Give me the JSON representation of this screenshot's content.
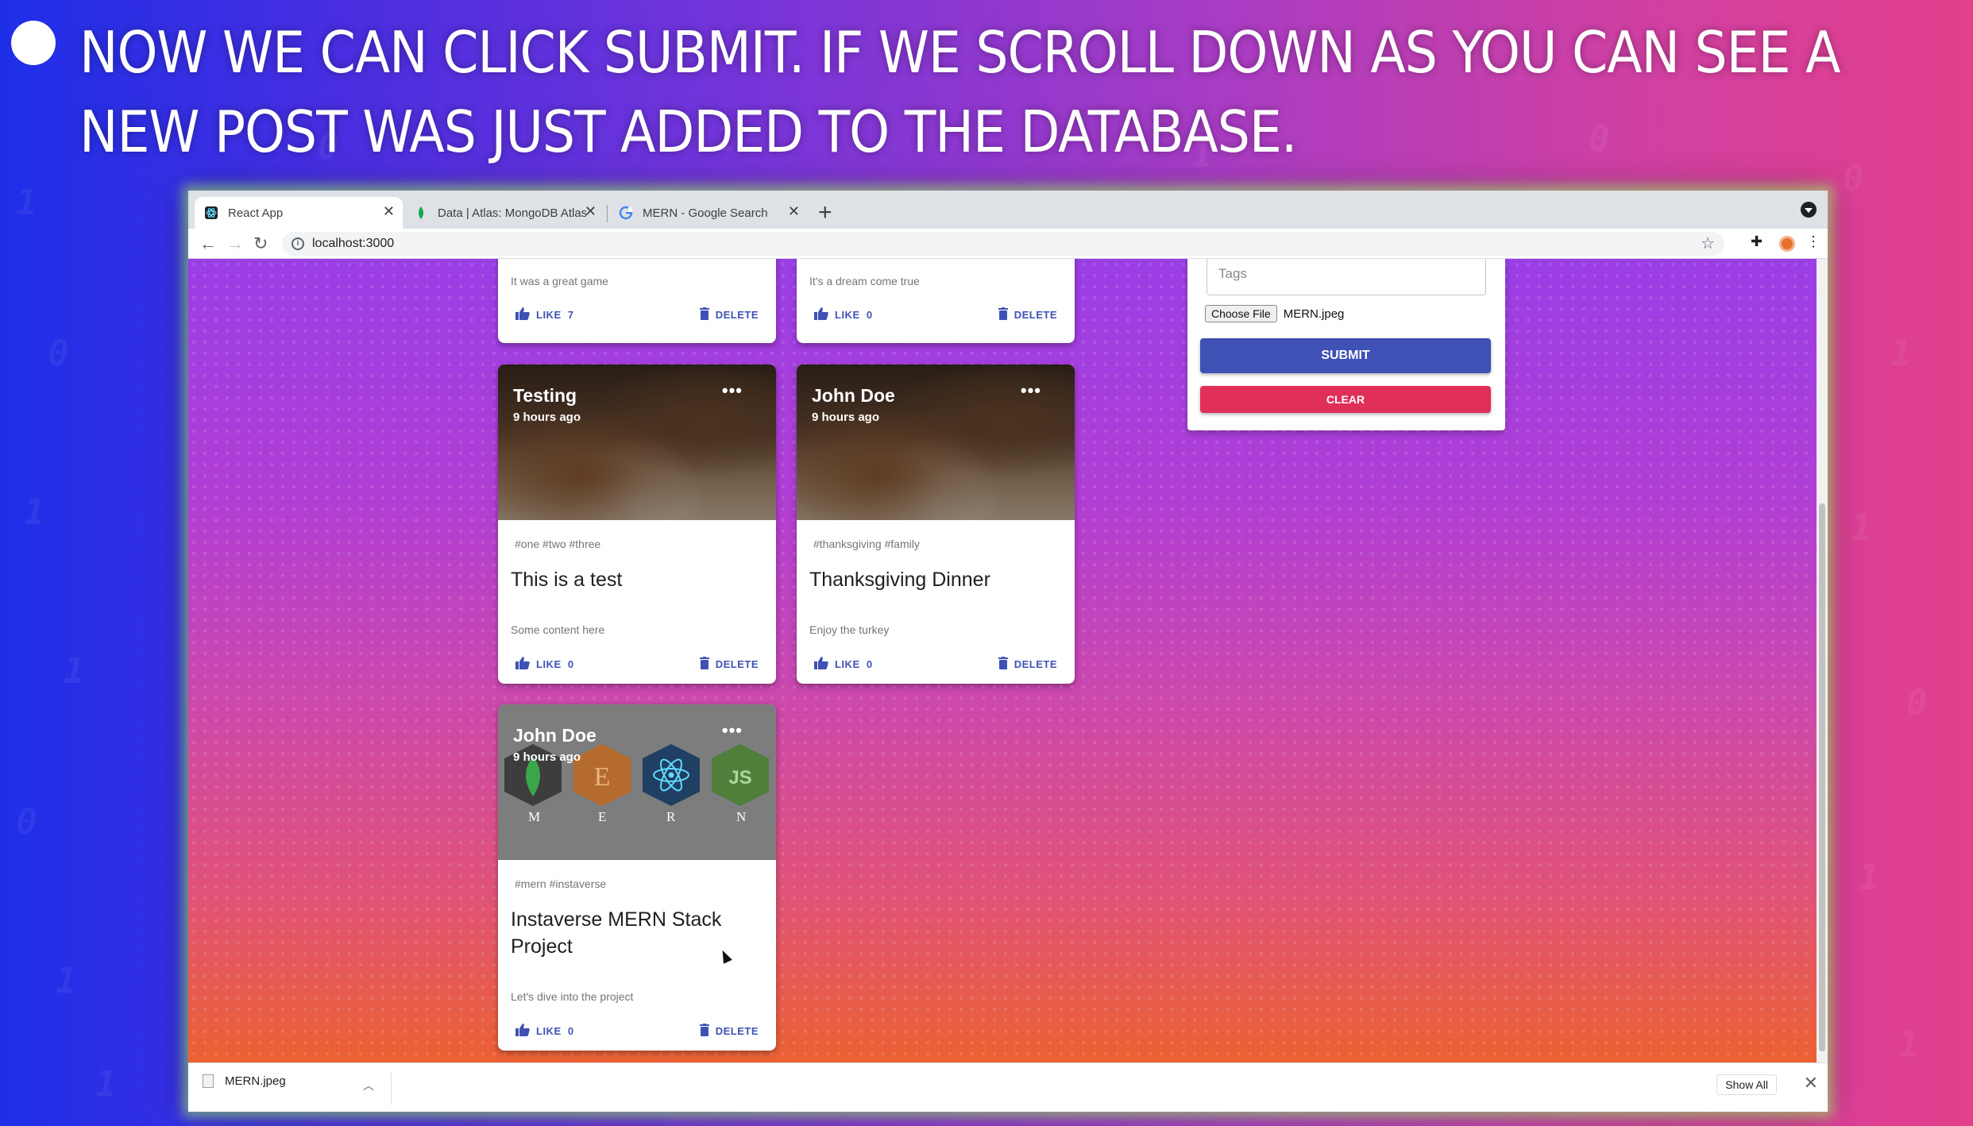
{
  "caption": {
    "text": "Now we can click submit. If we scroll down as you can see a new post was just added to the database."
  },
  "browser": {
    "tabs": [
      {
        "label": "React App",
        "active": true
      },
      {
        "label": "Data | Atlas: MongoDB Atlas",
        "active": false
      },
      {
        "label": "MERN - Google Search",
        "active": false
      }
    ],
    "url": "localhost:3000"
  },
  "posts_top": [
    {
      "message": "It was a great game",
      "like_label": "LIKE",
      "likes": "7",
      "delete_label": "DELETE"
    },
    {
      "message": "It's a dream come true",
      "like_label": "LIKE",
      "likes": "0",
      "delete_label": "DELETE"
    }
  ],
  "posts": [
    {
      "creator": "Testing",
      "time": "9 hours ago",
      "tags": "#one #two #three",
      "title": "This is a test",
      "message": "Some content here",
      "like_label": "LIKE",
      "likes": "0",
      "delete_label": "DELETE"
    },
    {
      "creator": "John Doe",
      "time": "9 hours ago",
      "tags": "#thanksgiving #family",
      "title": "Thanksgiving Dinner",
      "message": "Enjoy the turkey",
      "like_label": "LIKE",
      "likes": "0",
      "delete_label": "DELETE"
    },
    {
      "creator": "John Doe",
      "time": "9 hours ago",
      "tags": "#mern #instaverse",
      "title": "Instaverse MERN Stack Project",
      "message": "Let's dive into the project",
      "like_label": "LIKE",
      "likes": "0",
      "delete_label": "DELETE",
      "image_letters": [
        "M",
        "E",
        "R",
        "N"
      ]
    }
  ],
  "form": {
    "tags_placeholder": "Tags",
    "choose_file_label": "Choose File",
    "file_name": "MERN.jpeg",
    "submit_label": "SUBMIT",
    "clear_label": "CLEAR"
  },
  "downloads": {
    "file": "MERN.jpeg",
    "show_all_label": "Show All"
  },
  "colors": {
    "primary": "#3f51b5",
    "secondary": "#e0305a"
  }
}
